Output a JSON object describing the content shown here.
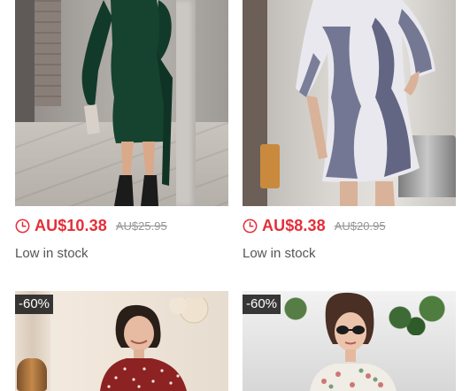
{
  "products": [
    {
      "image_alt": "green wrap dress",
      "sale_price": "AU$10.38",
      "original_price": "AU$25.95",
      "stock_status": "Low in stock"
    },
    {
      "image_alt": "tie-dye t-shirt dress",
      "sale_price": "AU$8.38",
      "original_price": "AU$20.95",
      "stock_status": "Low in stock"
    },
    {
      "image_alt": "red polka dot blouse",
      "discount_badge": "-60%"
    },
    {
      "image_alt": "floral top with sunglasses",
      "discount_badge": "-60%"
    }
  ],
  "colors": {
    "price_red": "#e52e38",
    "strike_gray": "#959595",
    "stock_text": "#555555",
    "badge_bg": "#222222"
  },
  "icons": {
    "flash_sale": "clock-icon"
  }
}
